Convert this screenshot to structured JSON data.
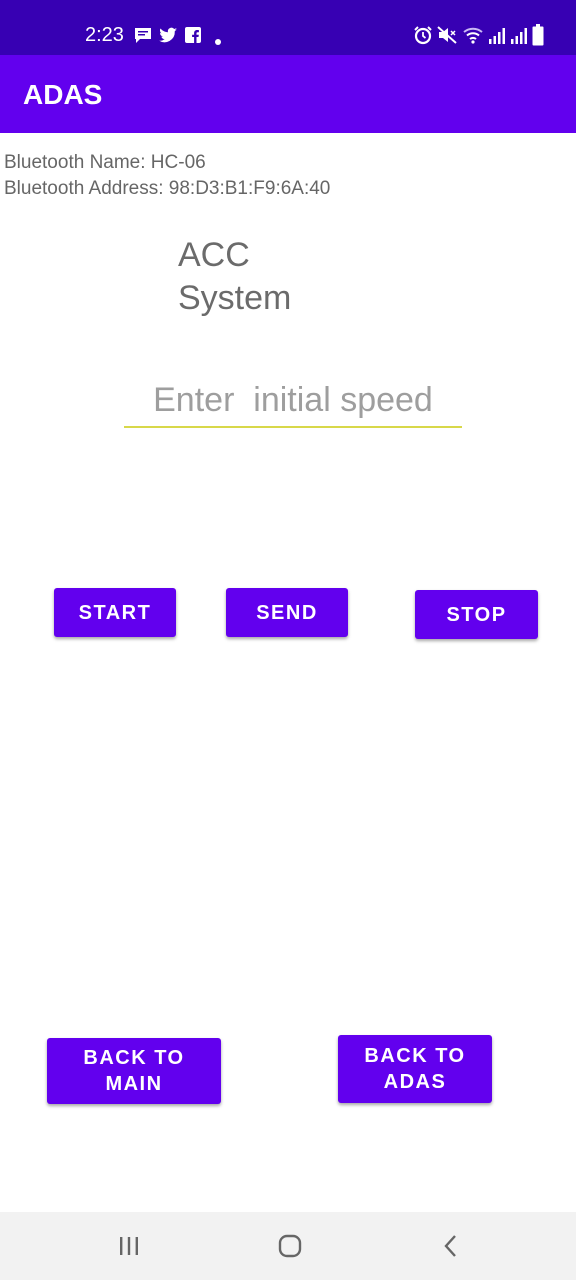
{
  "status_bar": {
    "time": "2:23",
    "notification_icons": [
      "message-icon",
      "twitter-icon",
      "facebook-icon",
      "dot-icon"
    ],
    "system_icons": [
      "alarm-icon",
      "mute-icon",
      "wifi-icon",
      "signal-icon",
      "signal-icon",
      "battery-icon"
    ]
  },
  "app_bar": {
    "title": "ADAS"
  },
  "bluetooth": {
    "name_line": "Bluetooth Name: HC-06",
    "address_line": "Bluetooth Address: 98:D3:B1:F9:6A:40"
  },
  "system_title": {
    "line1": "ACC",
    "line2": "System"
  },
  "speed_input": {
    "placeholder": "Enter  initial speed",
    "value": ""
  },
  "buttons": {
    "start": "START",
    "send": "SEND",
    "stop": "STOP",
    "back_main_line1": "BACK TO",
    "back_main_line2": "MAIN",
    "back_adas_line1": "BACK TO",
    "back_adas_line2": "ADAS"
  },
  "nav_bar": {
    "recents_icon": "recents-icon",
    "home_icon": "home-icon",
    "back_icon": "back-icon"
  },
  "colors": {
    "status_bar": "#3700b3",
    "primary": "#6200ee",
    "input_underline": "#d8d84a",
    "text_gray": "#666666"
  }
}
